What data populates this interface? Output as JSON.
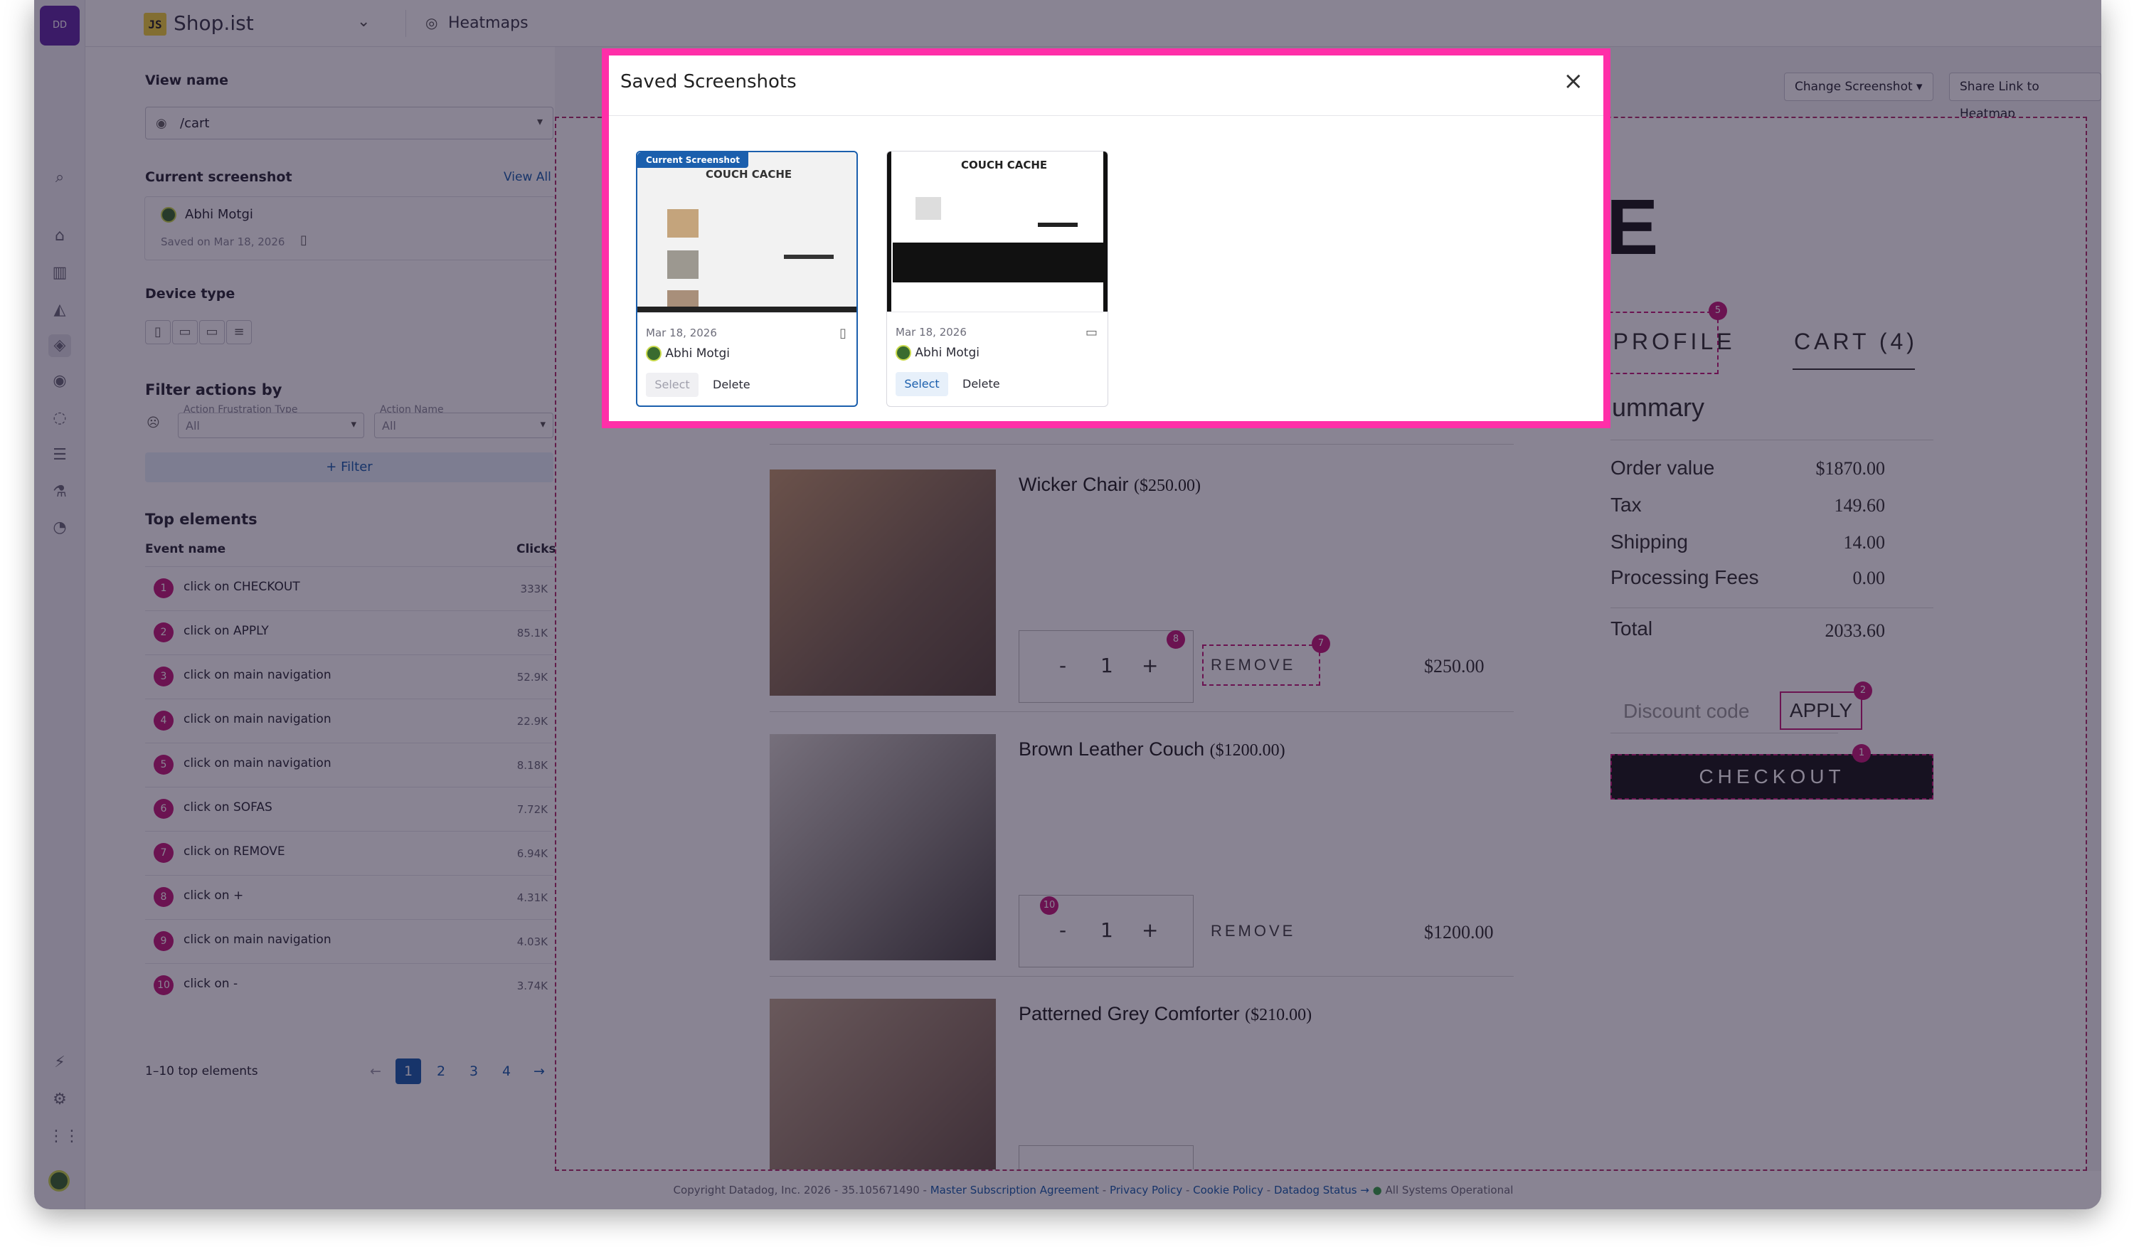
{
  "topbar": {
    "app_badge": "JS",
    "app_name": "Shop.ist",
    "section": "Heatmaps"
  },
  "panel": {
    "view_name_label": "View name",
    "view_name_value": "/cart",
    "current_screenshot_label": "Current screenshot",
    "view_all": "View All",
    "shot_user": "Abhi Motgi",
    "shot_saved": "Saved on Mar 18, 2026",
    "device_type_label": "Device type",
    "filter_actions_label": "Filter actions by",
    "frustration_label": "Action Frustration Type",
    "frustration_value": "All",
    "action_name_label": "Action Name",
    "action_name_value": "All",
    "filter_button": "Filter",
    "top_elements_label": "Top elements",
    "col_event": "Event name",
    "col_clicks": "Clicks",
    "rows": [
      {
        "n": "1",
        "event": "click on CHECKOUT",
        "clicks": "333K"
      },
      {
        "n": "2",
        "event": "click on APPLY",
        "clicks": "85.1K"
      },
      {
        "n": "3",
        "event": "click on main navigation",
        "clicks": "52.9K"
      },
      {
        "n": "4",
        "event": "click on main navigation",
        "clicks": "22.9K"
      },
      {
        "n": "5",
        "event": "click on main navigation",
        "clicks": "8.18K"
      },
      {
        "n": "6",
        "event": "click on SOFAS",
        "clicks": "7.72K"
      },
      {
        "n": "7",
        "event": "click on REMOVE",
        "clicks": "6.94K"
      },
      {
        "n": "8",
        "event": "click on +",
        "clicks": "4.31K"
      },
      {
        "n": "9",
        "event": "click on main navigation",
        "clicks": "4.03K"
      },
      {
        "n": "10",
        "event": "click on -",
        "clicks": "3.74K"
      }
    ],
    "range_text": "1–10 top elements",
    "pages": [
      "1",
      "2",
      "3",
      "4"
    ]
  },
  "toolbar": {
    "change_screenshot": "Change Screenshot",
    "share_link": "Share Link to Heatmap"
  },
  "preview": {
    "title_fragment": "E",
    "nav_profile": "Y PROFILE",
    "nav_cart": "CART (4)",
    "summary_title": "ummary",
    "summary": [
      {
        "label": "Order value",
        "value": "$1870.00"
      },
      {
        "label": "Tax",
        "value": "149.60"
      },
      {
        "label": "Shipping",
        "value": "14.00"
      },
      {
        "label": "Processing Fees",
        "value": "0.00"
      }
    ],
    "total_label": "Total",
    "total_value": "2033.60",
    "discount_placeholder": "Discount code",
    "apply": "APPLY",
    "checkout": "CHECKOUT",
    "items": [
      {
        "name": "Wicker Chair",
        "price_paren": "($250.00)",
        "qty": "1",
        "remove": "REMOVE",
        "price": "$250.00"
      },
      {
        "name": "Brown Leather Couch",
        "price_paren": "($1200.00)",
        "qty": "1",
        "remove": "REMOVE",
        "price": "$1200.00"
      },
      {
        "name": "Patterned Grey Comforter",
        "price_paren": "($210.00)"
      }
    ],
    "minus": "-",
    "plus": "+",
    "markers": [
      "5",
      "8",
      "7",
      "2",
      "1",
      "10"
    ]
  },
  "footer": {
    "copyright": "Copyright Datadog, Inc. 2026 - 35.105671490 -",
    "msa": "Master Subscription Agreement",
    "privacy": "Privacy Policy",
    "cookie": "Cookie Policy",
    "status": "Datadog Status →",
    "operational": "All Systems Operational"
  },
  "modal": {
    "title": "Saved Screenshots",
    "close": "×",
    "cards": [
      {
        "badge": "Current Screenshot",
        "thumb_title": "COUCH CACHE",
        "date": "Mar 18, 2026",
        "user": "Abhi Motgi",
        "select": "Select",
        "delete": "Delete",
        "device_icon": "tablet-icon"
      },
      {
        "thumb_title": "COUCH CACHE",
        "date": "Mar 18, 2026",
        "user": "Abhi Motgi",
        "select": "Select",
        "delete": "Delete",
        "device_icon": "desktop-icon"
      }
    ]
  },
  "colors": {
    "accent": "#1b5fad",
    "marker": "#c31d7b",
    "modal_border": "#ff2fa8",
    "brand": "#632ca6"
  }
}
